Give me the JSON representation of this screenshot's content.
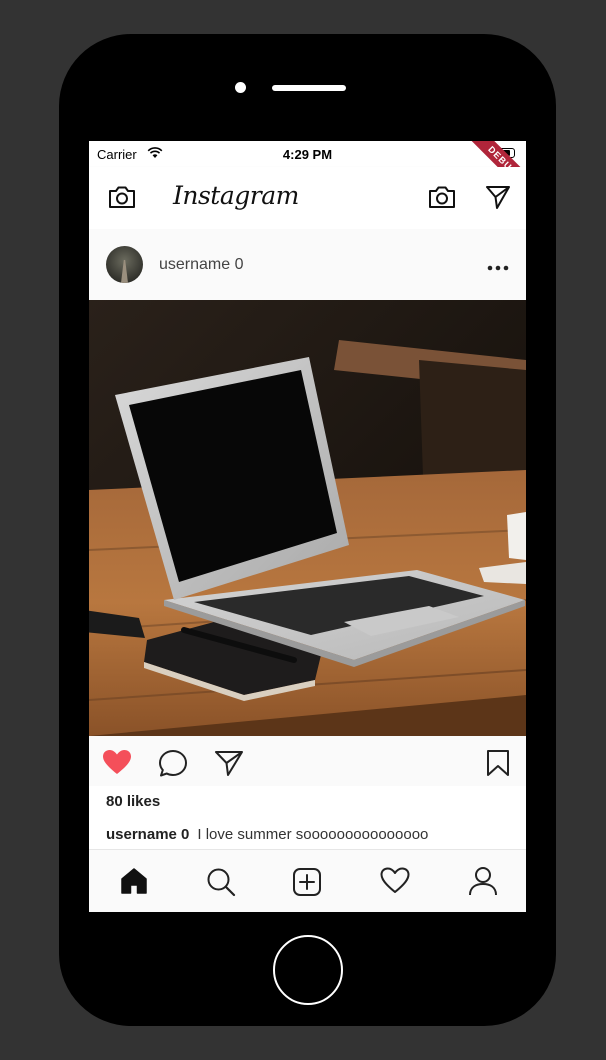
{
  "status_bar": {
    "carrier": "Carrier",
    "time": "4:29 PM"
  },
  "debug_banner": "DEBUG",
  "app_bar": {
    "logo_text": "Instagram",
    "icons": [
      "camera-icon",
      "camera-icon",
      "send-icon"
    ]
  },
  "post": {
    "username": "username 0",
    "menu_icon": "more-horizontal-icon",
    "image_description_icon": "post-photo",
    "liked": true,
    "like_color": "#f44f5a",
    "likes_text": "80 likes",
    "caption_user": "username 0",
    "caption_text": "I love summer sooooooooooooooo much.......... !!!!!"
  },
  "bottom_nav": {
    "items": [
      "home-icon",
      "search-icon",
      "add-box-icon",
      "heart-icon",
      "profile-icon"
    ],
    "active": "home-icon"
  }
}
